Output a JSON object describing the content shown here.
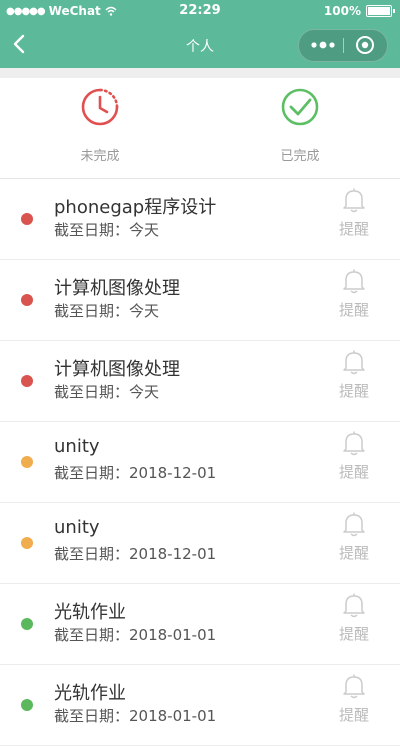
{
  "status_bar": {
    "carrier": "WeChat",
    "time": "22:29",
    "battery": "100%"
  },
  "nav": {
    "title": "个人"
  },
  "tabs": [
    {
      "label": "未完成",
      "color": "#e05050"
    },
    {
      "label": "已完成",
      "color": "#5cbf64"
    }
  ],
  "tasks": [
    {
      "title": "phonegap程序设计",
      "due": "截至日期：今天",
      "color": "#d9534f",
      "remind_label": "提醒"
    },
    {
      "title": "计算机图像处理",
      "due": "截至日期：今天",
      "color": "#d9534f",
      "remind_label": "提醒"
    },
    {
      "title": "计算机图像处理",
      "due": "截至日期：今天",
      "color": "#d9534f",
      "remind_label": "提醒"
    },
    {
      "title": "unity",
      "due": "截至日期：2018-12-01",
      "color": "#f0ad4e",
      "remind_label": "提醒"
    },
    {
      "title": "unity",
      "due": "截至日期：2018-12-01",
      "color": "#f0ad4e",
      "remind_label": "提醒"
    },
    {
      "title": "光轨作业",
      "due": "截至日期：2018-01-01",
      "color": "#5cb85c",
      "remind_label": "提醒"
    },
    {
      "title": "光轨作业",
      "due": "截至日期：2018-01-01",
      "color": "#5cb85c",
      "remind_label": "提醒"
    }
  ]
}
